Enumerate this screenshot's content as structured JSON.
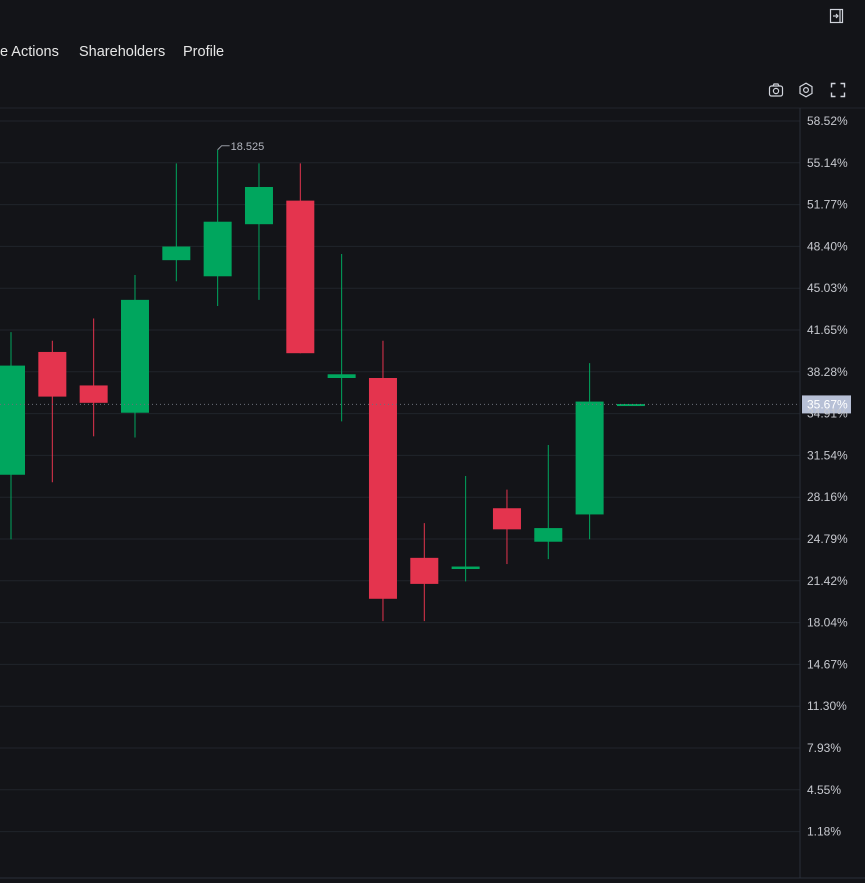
{
  "tabs": [
    "e Actions",
    "Shareholders",
    "Profile"
  ],
  "icons": {
    "top_right": "exit-panel-icon",
    "toolbar": [
      "camera-icon",
      "settings-icon",
      "fullscreen-icon"
    ]
  },
  "colors": {
    "background": "#131418",
    "up": "#00a65e",
    "down": "#e4344e",
    "grid": "#21242b",
    "current_label_bg": "#b7c0d6"
  },
  "chart_data": {
    "type": "candlestick",
    "y_axis_unit": "%",
    "ylim": [
      0,
      60
    ],
    "y_ticks": [
      "58.52%",
      "55.14%",
      "51.77%",
      "48.40%",
      "45.03%",
      "41.65%",
      "38.28%",
      "34.91%",
      "31.54%",
      "28.16%",
      "24.79%",
      "21.42%",
      "18.04%",
      "14.67%",
      "11.30%",
      "7.93%",
      "4.55%",
      "1.18%"
    ],
    "current_value_label": "35.67%",
    "high_annotation": "18.525",
    "candles": [
      {
        "open": 30.0,
        "close": 38.8,
        "high": 41.5,
        "low": 24.8
      },
      {
        "open": 39.9,
        "close": 36.3,
        "high": 40.8,
        "low": 29.4
      },
      {
        "open": 37.2,
        "close": 35.8,
        "high": 42.6,
        "low": 33.1
      },
      {
        "open": 35.0,
        "close": 44.1,
        "high": 46.1,
        "low": 33.0
      },
      {
        "open": 47.3,
        "close": 48.4,
        "high": 55.1,
        "low": 45.6
      },
      {
        "open": 46.0,
        "close": 50.4,
        "high": 56.2,
        "low": 43.6
      },
      {
        "open": 50.2,
        "close": 53.2,
        "high": 55.1,
        "low": 44.1
      },
      {
        "open": 52.1,
        "close": 39.8,
        "high": 55.1,
        "low": 39.8
      },
      {
        "open": 37.8,
        "close": 38.1,
        "high": 47.8,
        "low": 34.3
      },
      {
        "open": 37.8,
        "close": 20.0,
        "high": 40.8,
        "low": 18.2
      },
      {
        "open": 23.3,
        "close": 21.2,
        "high": 26.1,
        "low": 18.2
      },
      {
        "open": 22.4,
        "close": 22.6,
        "high": 29.9,
        "low": 21.4
      },
      {
        "open": 27.3,
        "close": 25.6,
        "high": 28.8,
        "low": 22.8
      },
      {
        "open": 24.6,
        "close": 25.7,
        "high": 32.4,
        "low": 23.2
      },
      {
        "open": 26.8,
        "close": 35.9,
        "high": 39.0,
        "low": 24.8
      },
      {
        "open": 35.7,
        "close": 35.7,
        "high": 35.7,
        "low": 35.7
      }
    ]
  }
}
